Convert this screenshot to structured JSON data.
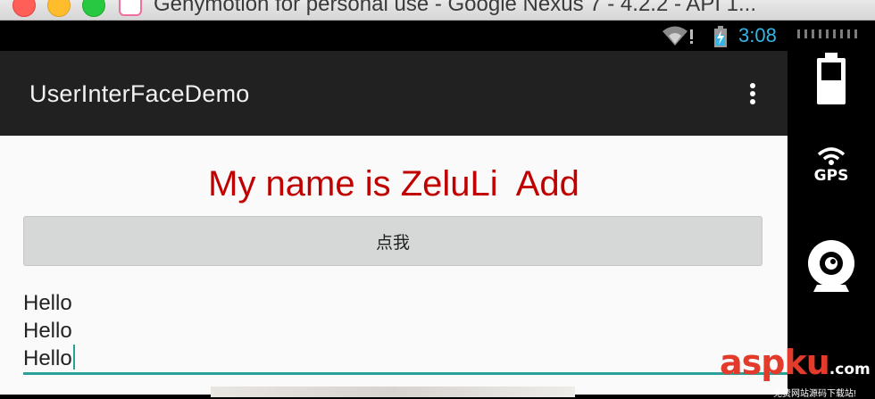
{
  "window": {
    "title": "Genymotion for personal use - Google Nexus 7 - 4.2.2 - API 1..."
  },
  "status_bar": {
    "time": "3:08",
    "icons": [
      "wifi-icon",
      "battery-charging-icon"
    ],
    "accent_color": "#33b5e5"
  },
  "action_bar": {
    "title": "UserInterFaceDemo",
    "overflow_icon": "overflow-menu-icon"
  },
  "content": {
    "headline": "My name is ZeluLi  Add",
    "headline_color": "#c00000",
    "button_label": "点我",
    "edit_text_lines": [
      "Hello",
      "Hello",
      "Hello"
    ],
    "edit_text_underline_color": "#2aa198"
  },
  "side_toolbar": {
    "items": [
      {
        "icon": "battery-icon"
      },
      {
        "icon": "gps-icon",
        "label": "GPS"
      },
      {
        "icon": "webcam-icon"
      }
    ]
  },
  "watermark": {
    "brand": "aspku",
    "suffix": ".com",
    "tagline": "免费网站源码下载站!"
  }
}
